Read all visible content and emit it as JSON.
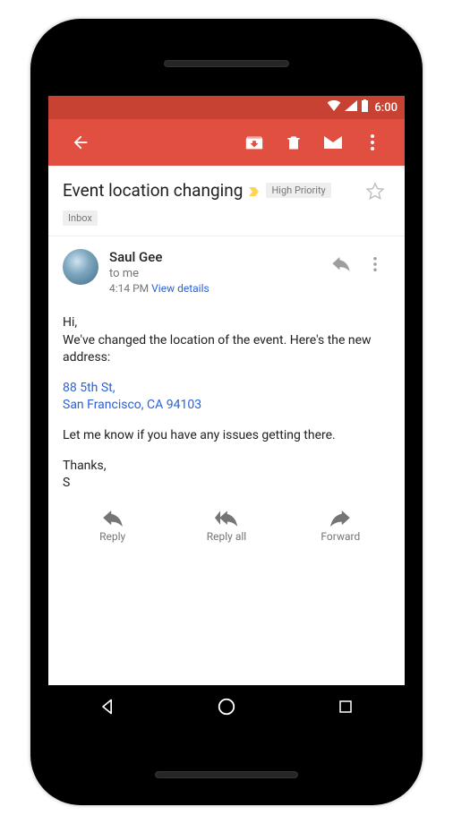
{
  "status": {
    "time": "6:00"
  },
  "appbar": {
    "back": "Back",
    "archive": "Archive",
    "delete": "Delete",
    "unread": "Mark unread",
    "more": "More"
  },
  "email": {
    "subject": "Event location changing",
    "priority_label": "High Priority",
    "folder_label": "Inbox",
    "sender": "Saul Gee",
    "recipient": "to me",
    "timestamp": "4:14 PM",
    "view_details": "View details",
    "body": {
      "greeting": "Hi,",
      "line1": "We've changed the location of the event. Here's the new address:",
      "address_line1": "88 5th St,",
      "address_line2": "San Francisco, CA 94103",
      "line2": "Let me know if you have any issues getting there.",
      "closing1": "Thanks,",
      "closing2": "S"
    }
  },
  "actions": {
    "reply": "Reply",
    "reply_all": "Reply all",
    "forward": "Forward"
  }
}
